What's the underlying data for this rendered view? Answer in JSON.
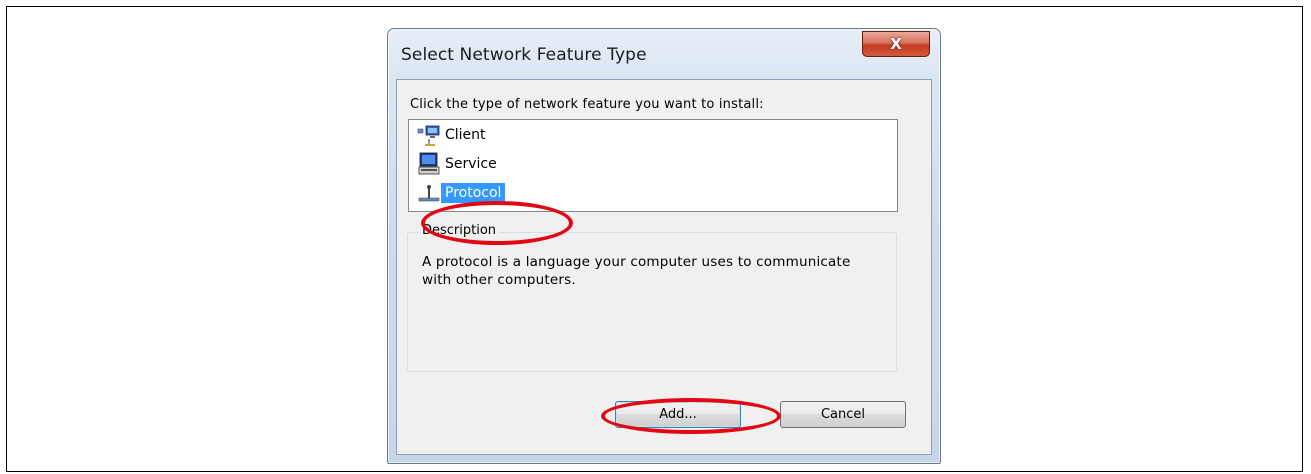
{
  "dialog": {
    "title": "Select Network Feature Type",
    "close_symbol": "X",
    "prompt": "Click the type of network feature you want to install:",
    "items": [
      {
        "label": "Client",
        "icon": "client-icon",
        "selected": false
      },
      {
        "label": "Service",
        "icon": "service-icon",
        "selected": false
      },
      {
        "label": "Protocol",
        "icon": "protocol-icon",
        "selected": true
      }
    ],
    "description_label": "Description",
    "description_text": "A protocol is a language your computer uses to communicate with other computers.",
    "add_label": "Add...",
    "cancel_label": "Cancel"
  },
  "colors": {
    "selection": "#3399ff",
    "annotation_red": "#e30613",
    "close_button": "#c23b22"
  }
}
